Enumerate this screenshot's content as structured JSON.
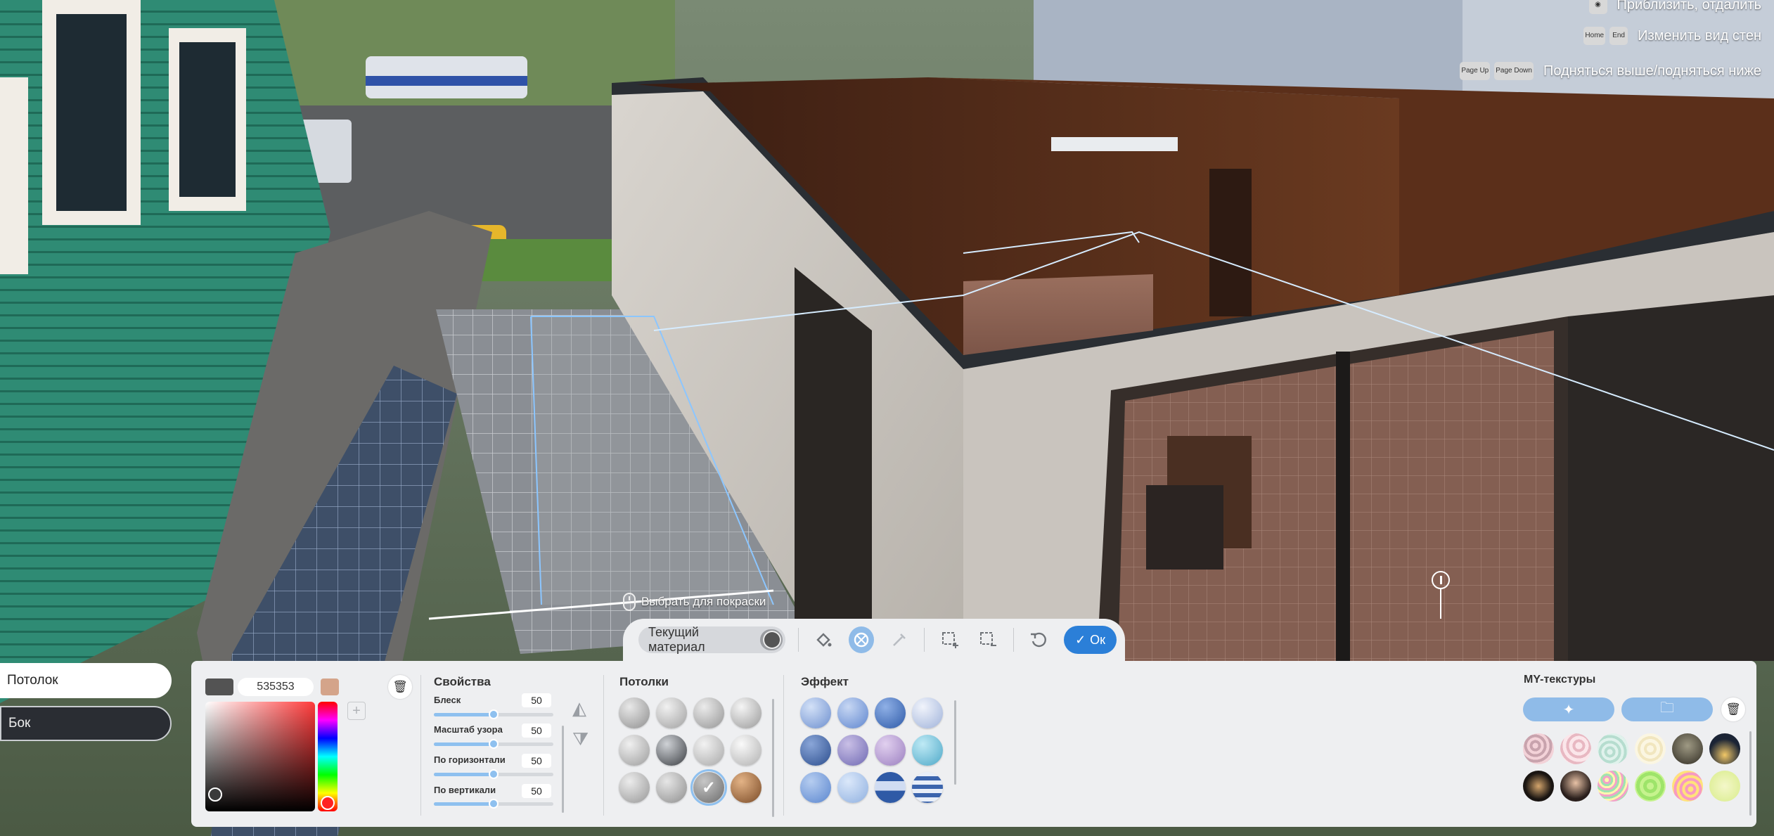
{
  "hints": [
    {
      "keys": [],
      "text": "Приблизить, отдалить"
    },
    {
      "keys": [
        "Home",
        "End"
      ],
      "text": "Изменить вид стен"
    },
    {
      "keys": [
        "Page Up",
        "Page Down"
      ],
      "text": "Подняться выше/подняться ниже"
    }
  ],
  "side_tabs": [
    {
      "label": "Потолок",
      "active": true
    },
    {
      "label": "Бок",
      "active": false
    }
  ],
  "pick_hint": "Выбрать для покраски",
  "toolbar": {
    "current_material": "Текущий материал",
    "ok_label": "Ок"
  },
  "color": {
    "hex": "535353",
    "swatch": "#535353",
    "secondary_swatch": "#d4a48a"
  },
  "properties": {
    "title": "Свойства",
    "items": [
      {
        "label": "Блеск",
        "value": "50"
      },
      {
        "label": "Масштаб узора",
        "value": "50"
      },
      {
        "label": "По горизонтали",
        "value": "50"
      },
      {
        "label": "По вертикали",
        "value": "50"
      }
    ]
  },
  "ceilings": {
    "title": "Потолки",
    "selected_index": 8
  },
  "effect": {
    "title": "Эффект"
  },
  "my_textures": {
    "title": "MY-текстуры"
  },
  "colors": {
    "accent": "#2b7fd8",
    "accent_light": "#8fbbe8",
    "panel_bg": "#eeeff1"
  }
}
